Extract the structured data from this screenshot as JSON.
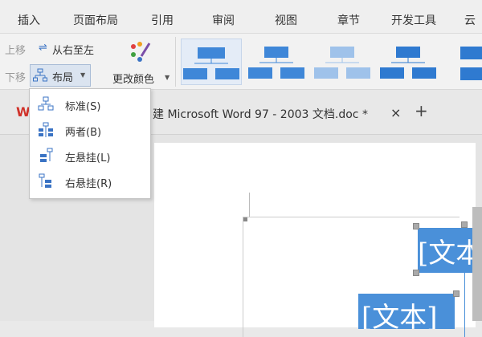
{
  "menu": {
    "items": [
      "插入",
      "页面布局",
      "引用",
      "审阅",
      "视图",
      "章节",
      "开发工具",
      "云"
    ]
  },
  "ribbon": {
    "move_up": "上移",
    "move_down": "下移",
    "right_to_left": "从右至左",
    "layout_label": "布局",
    "change_color_label": "更改颜色"
  },
  "tab": {
    "title": "建 Microsoft Word 97 - 2003 文档.doc *",
    "close": "×",
    "new": "+"
  },
  "dropdown": {
    "items": [
      {
        "label": "标准(S)",
        "icon": "org-standard-icon"
      },
      {
        "label": "两者(B)",
        "icon": "org-both-icon"
      },
      {
        "label": "左悬挂(L)",
        "icon": "org-left-hanging-icon"
      },
      {
        "label": "右悬挂(R)",
        "icon": "org-right-hanging-icon"
      }
    ]
  },
  "document": {
    "textbox_1": "[文本]",
    "textbox_2": "[文本]"
  },
  "colors": {
    "accent_blue": "#4a90d9",
    "wps_red": "#d0322a",
    "selection_bg": "#dbe4f0"
  }
}
